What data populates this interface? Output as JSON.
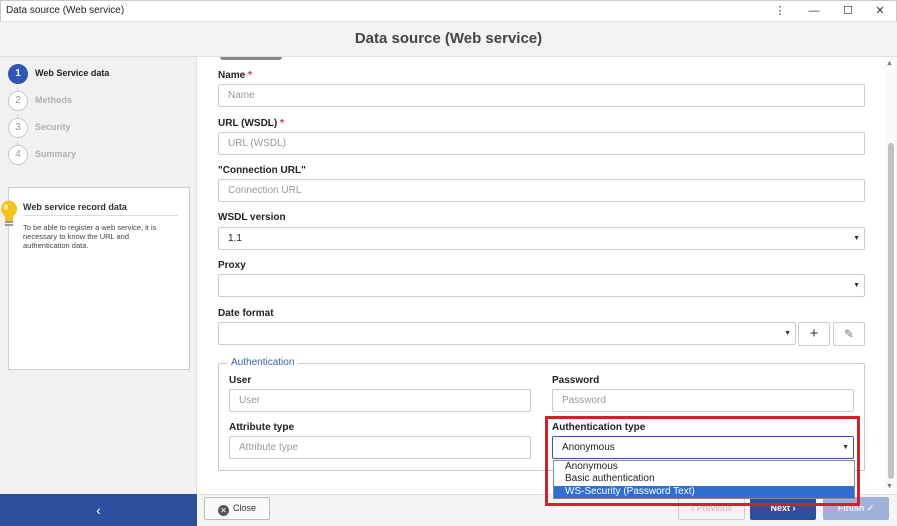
{
  "window": {
    "title": "Data source (Web service)",
    "controls": {
      "menu": "⋮",
      "minimize": "—",
      "maximize": "☐",
      "close": "✕"
    }
  },
  "header": {
    "title": "Data source (Web service)"
  },
  "steps": [
    {
      "number": "1",
      "label": "Web Service data",
      "active": true
    },
    {
      "number": "2",
      "label": "Methods",
      "active": false
    },
    {
      "number": "3",
      "label": "Security",
      "active": false
    },
    {
      "number": "4",
      "label": "Summary",
      "active": false
    }
  ],
  "info": {
    "title": "Web service record data",
    "text": "To be able to register a web service, it is necessary to know the URL and authentication data.",
    "icon": "lightbulb-icon"
  },
  "sidebar_footer": {
    "collapse_icon": "‹"
  },
  "form": {
    "name": {
      "label": "Name",
      "required": "*",
      "placeholder": "Name"
    },
    "url": {
      "label": "URL (WSDL)",
      "required": "*",
      "placeholder": "URL (WSDL)"
    },
    "connection_url": {
      "label": "\"Connection URL\"",
      "placeholder": "Connection URL"
    },
    "wsdl_version": {
      "label": "WSDL version",
      "value": "1.1"
    },
    "proxy": {
      "label": "Proxy",
      "value": ""
    },
    "date_format": {
      "label": "Date format",
      "value": "",
      "add_icon": "+",
      "edit_icon": "✎"
    },
    "caret": "▼"
  },
  "authentication": {
    "legend": "Authentication",
    "user": {
      "label": "User",
      "placeholder": "User"
    },
    "password": {
      "label": "Password",
      "placeholder": "Password"
    },
    "attribute_type": {
      "label": "Attribute type",
      "placeholder": "Attribute type"
    },
    "auth_type": {
      "label": "Authentication type",
      "value": "Anonymous",
      "options": [
        "Anonymous",
        "Basic authentication",
        "WS-Security (Password Text)"
      ],
      "highlighted_index": 2
    }
  },
  "footer": {
    "close": "Close",
    "previous": "Previous",
    "next": "Next",
    "finish": "Finish"
  },
  "colors": {
    "accent": "#2c4f9e",
    "step_active": "#2f55b7",
    "required": "#d9302f",
    "highlight_box": "#d61f26",
    "dropdown_selected": "#2f6fd1"
  }
}
